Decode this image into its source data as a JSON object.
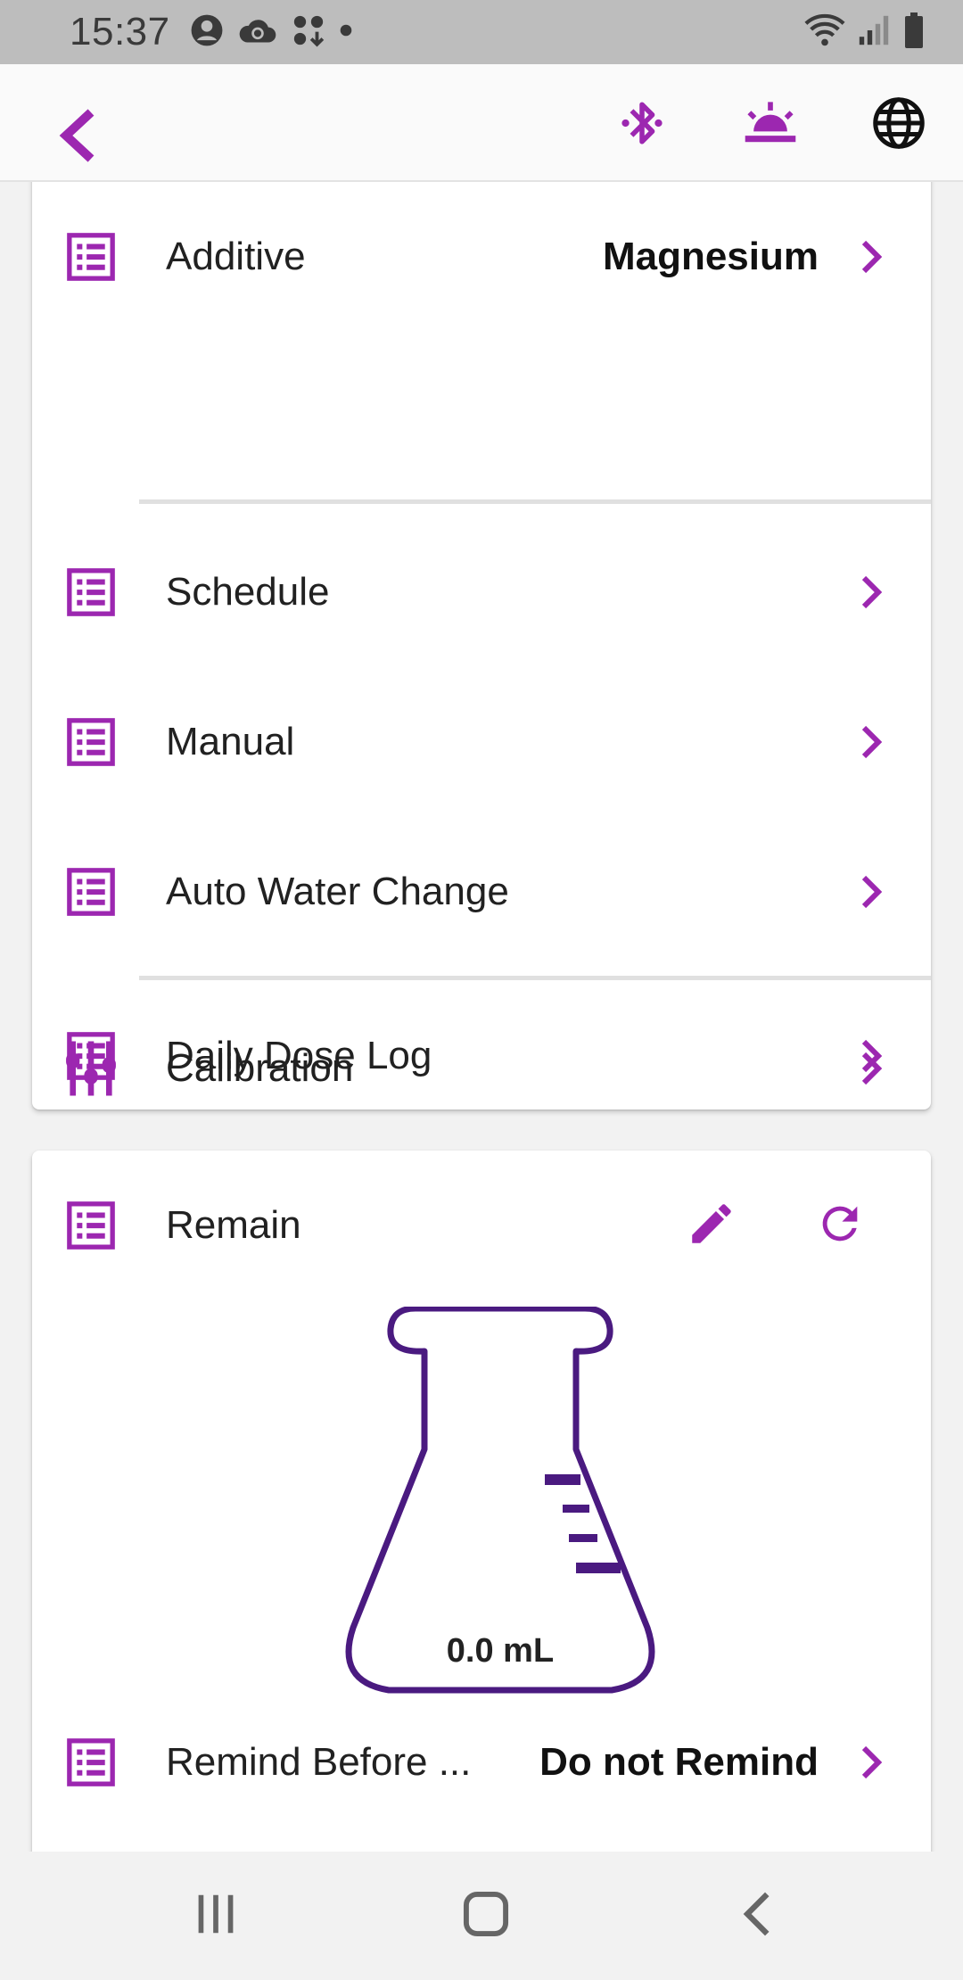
{
  "status_bar": {
    "time": "15:37"
  },
  "app_bar": {
    "back_icon": "chevron-left-icon",
    "actions": [
      "bluetooth-icon",
      "sunrise-icon",
      "globe-icon"
    ]
  },
  "settings_card": {
    "rows": [
      {
        "label": "Additive",
        "value": "Magnesium",
        "icon": "list-icon"
      },
      {
        "label": "Schedule",
        "value": "",
        "icon": "list-icon"
      },
      {
        "label": "Manual",
        "value": "",
        "icon": "list-icon"
      },
      {
        "label": "Auto Water Change",
        "value": "",
        "icon": "list-icon"
      },
      {
        "label": "Calibration",
        "value": "",
        "icon": "sliders-icon"
      },
      {
        "label": "Daily Dose Log",
        "value": "",
        "icon": "list-icon"
      }
    ]
  },
  "remain_card": {
    "title": "Remain",
    "volume": "0.0 mL",
    "remind": {
      "label": "Remind Before ...",
      "value": "Do not Remind"
    }
  },
  "colors": {
    "accent": "#9c27b0",
    "flask_stroke": "#4a1a80",
    "status_bar": "#bdbdbd"
  }
}
